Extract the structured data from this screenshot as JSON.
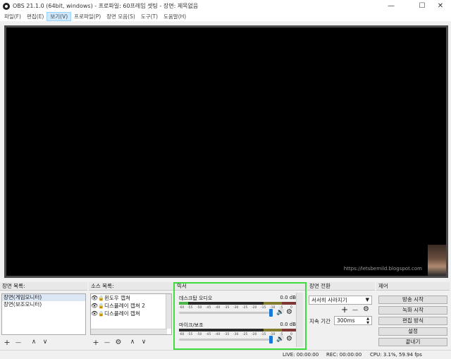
{
  "window": {
    "title": "OBS 21.1.0 (64bit, windows) - 프로파일: 60프레임 셋팅 - 장면: 제목없음",
    "controls": {
      "minimize": "—",
      "maximize": "☐",
      "close": "✕"
    }
  },
  "menu": {
    "items": [
      {
        "label": "파일(F)"
      },
      {
        "label": "편집(E)"
      },
      {
        "label": "보기(V)",
        "active": true
      },
      {
        "label": "프로파일(P)"
      },
      {
        "label": "장면 모음(S)"
      },
      {
        "label": "도구(T)"
      },
      {
        "label": "도움말(H)"
      }
    ]
  },
  "preview": {
    "overlay_url": "https://letsbemild.blogspot.com"
  },
  "scenes": {
    "title": "장면 목록:",
    "items": [
      {
        "label": "장면(게임모니터)",
        "selected": true
      },
      {
        "label": "장면(보조모니터)",
        "selected": false
      }
    ],
    "toolbar": {
      "add": "+",
      "remove": "—",
      "up": "∧",
      "down": "∨"
    }
  },
  "sources": {
    "title": "소스 목록:",
    "items": [
      {
        "label": "윈도우 캡쳐"
      },
      {
        "label": "디스플레이 캡쳐 2"
      },
      {
        "label": "디스플레이 캡쳐"
      }
    ],
    "toolbar": {
      "add": "+",
      "remove": "—",
      "settings": "⚙",
      "up": "∧",
      "down": "∨"
    }
  },
  "mixer": {
    "title": "믹서",
    "ticks": [
      "-60",
      "-55",
      "-50",
      "-45",
      "-40",
      "-35",
      "-30",
      "-25",
      "-20",
      "-15",
      "-10",
      "-5",
      "0"
    ],
    "channels": [
      {
        "name": "데스크탑 오디오",
        "db": "0.0 dB",
        "level": 0.08
      },
      {
        "name": "마이크/보조",
        "db": "0.0 dB",
        "level": 0.0
      }
    ],
    "mute_icon": "🔊",
    "settings_icon": "⚙"
  },
  "transitions": {
    "title": "장면 전환",
    "selected": "서서히 사라지기",
    "add": "+",
    "remove": "—",
    "settings": "⚙",
    "duration_label": "지속 기간",
    "duration_value": "300ms"
  },
  "controls": {
    "title": "제어",
    "buttons": [
      {
        "label": "방송 시작"
      },
      {
        "label": "녹화 시작"
      },
      {
        "label": "편집 방식"
      },
      {
        "label": "설정"
      },
      {
        "label": "끝내기"
      }
    ]
  },
  "status": {
    "live": "LIVE: 00:00:00",
    "rec": "REC: 00:00:00",
    "cpu": "CPU: 3.1%, 59.94 fps"
  },
  "colors": {
    "highlight": "#3fdc3f",
    "slider_handle": "#1979d8",
    "meter_green": "#4db548"
  }
}
